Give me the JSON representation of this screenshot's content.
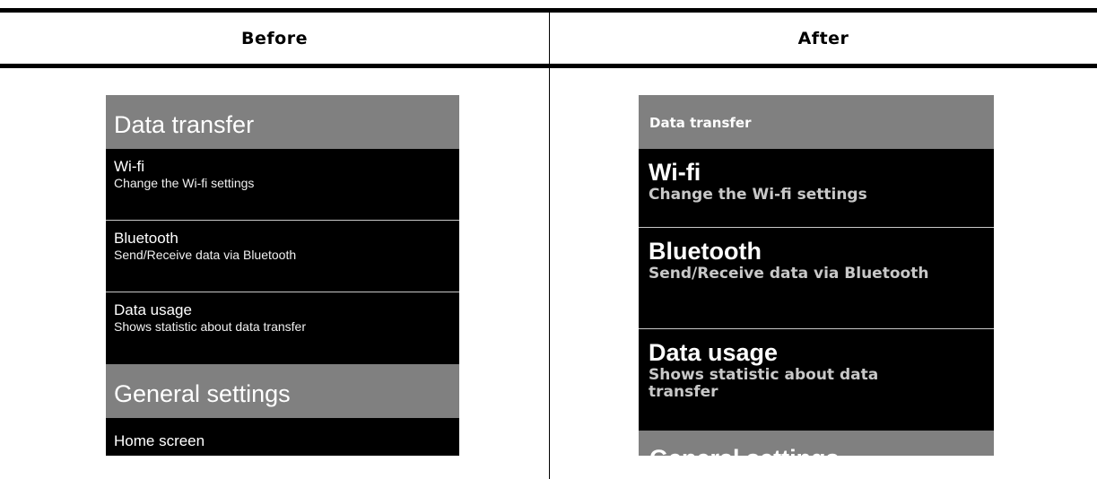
{
  "columns": {
    "before_label": "Before",
    "after_label": "After"
  },
  "before": {
    "section1": "Data transfer",
    "items": [
      {
        "title": "Wi-fi",
        "subtitle": "Change the Wi-fi settings"
      },
      {
        "title": "Bluetooth",
        "subtitle": "Send/Receive data via Bluetooth"
      },
      {
        "title": "Data usage",
        "subtitle": "Shows statistic about data transfer"
      }
    ],
    "section2": "General settings",
    "items2": [
      {
        "title": "Home screen"
      }
    ]
  },
  "after": {
    "section1": "Data transfer",
    "items": [
      {
        "title": "Wi-fi",
        "subtitle": "Change the Wi-fi settings"
      },
      {
        "title": "Bluetooth",
        "subtitle": "Send/Receive data via Bluetooth"
      },
      {
        "title": "Data usage",
        "subtitle": "Shows statistic about data transfer"
      }
    ],
    "section2": "General settings"
  },
  "colors": {
    "section_bg": "#808080",
    "item_bg": "#000000",
    "text": "#ffffff",
    "subtitle_after": "#c8c8c8"
  }
}
